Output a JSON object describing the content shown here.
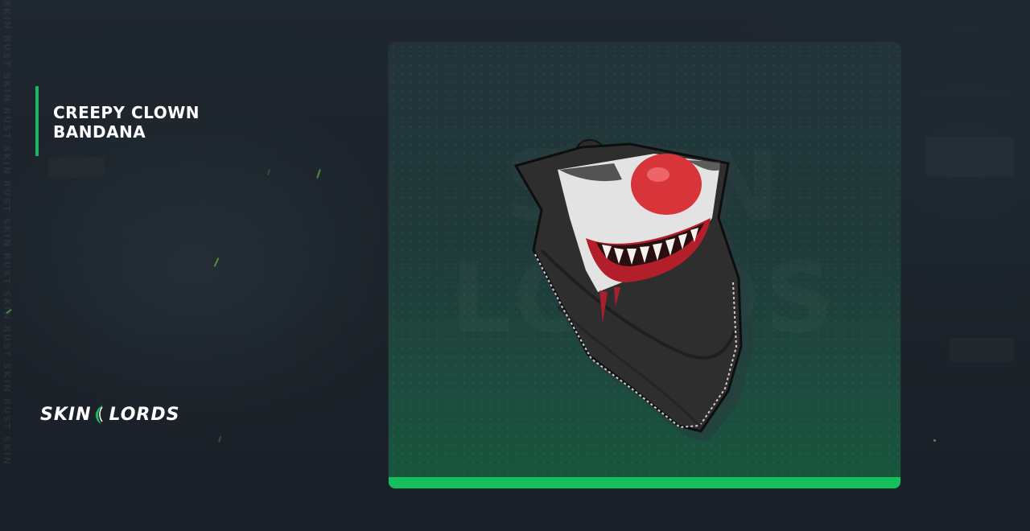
{
  "item": {
    "title_line1": "CREEPY CLOWN",
    "title_line2": "BANDANA",
    "image_icon": "clown-bandana-skin-icon",
    "rarity_color": "#14c05c"
  },
  "brand": {
    "logo_left": "SKIN",
    "logo_right": "LORDS",
    "logo_icon": "green-crescent-icon",
    "accent_color": "#1db65f"
  },
  "watermark": {
    "side_text": "SKIN RUST SKIN RUST SKIN RUST SKIN RUST SKIN RUST SKIN RUST SKIN"
  }
}
